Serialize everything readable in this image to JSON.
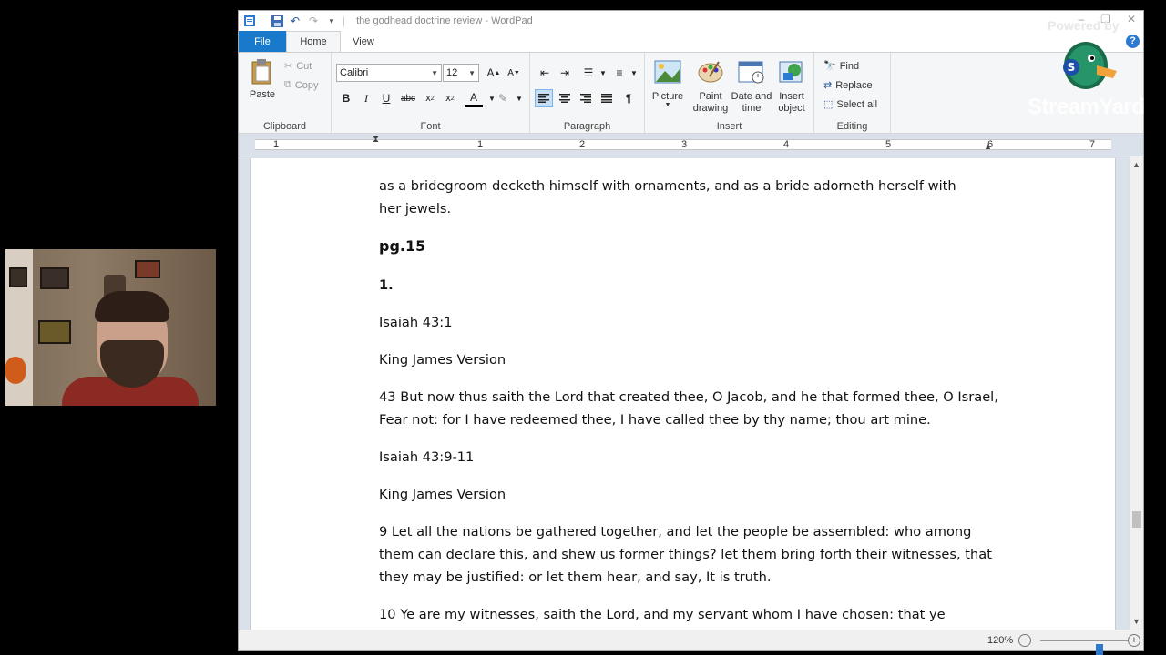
{
  "window": {
    "title": "the godhead doctrine review - WordPad",
    "controls": [
      "–",
      "❐",
      "✕"
    ]
  },
  "overlay": {
    "powered_by": "Powered by",
    "brand": "StreamYard",
    "help": "?"
  },
  "tabs": [
    {
      "label": "File"
    },
    {
      "label": "Home"
    },
    {
      "label": "View"
    }
  ],
  "ribbon": {
    "clipboard": {
      "label": "Clipboard",
      "paste": "Paste",
      "cut": "Cut",
      "copy": "Copy"
    },
    "font": {
      "label": "Font",
      "family": "Calibri",
      "size": "12"
    },
    "paragraph": {
      "label": "Paragraph"
    },
    "insert": {
      "label": "Insert",
      "picture": "Picture",
      "paint1": "Paint",
      "paint2": "drawing",
      "date1": "Date and",
      "date2": "time",
      "object1": "Insert",
      "object2": "object"
    },
    "editing": {
      "label": "Editing",
      "find": "Find",
      "replace": "Replace",
      "select_all": "Select all"
    }
  },
  "ruler": {
    "numbers": [
      "1",
      "1",
      "2",
      "3",
      "4",
      "5",
      "6",
      "7"
    ]
  },
  "document": {
    "line1": "as a bridegroom decketh himself with ornaments, and as a bride adorneth herself with",
    "line2": "her jewels.",
    "page_heading": "pg.15",
    "item_number": "1.",
    "ref1": "Isaiah 43:1",
    "version1": "King James Version",
    "verse43": "43 But now thus saith the Lord that created thee, O Jacob, and he that formed thee, O Israel, Fear not: for I have redeemed thee, I have called  thee by thy name; thou art mine.",
    "ref2": "Isaiah 43:9-11",
    "version2": "King James Version",
    "verse9": "9 Let all the nations be gathered together, and let the people be assembled: who among them can declare this, and shew us former things? let them bring forth their witnesses, that they may be justified: or let them hear, and say, It is truth.",
    "verse10": "10 Ye are my witnesses, saith the Lord, and my servant whom I have chosen: that ye"
  },
  "status": {
    "zoom": "120%",
    "zoom_fraction": 0.68
  }
}
